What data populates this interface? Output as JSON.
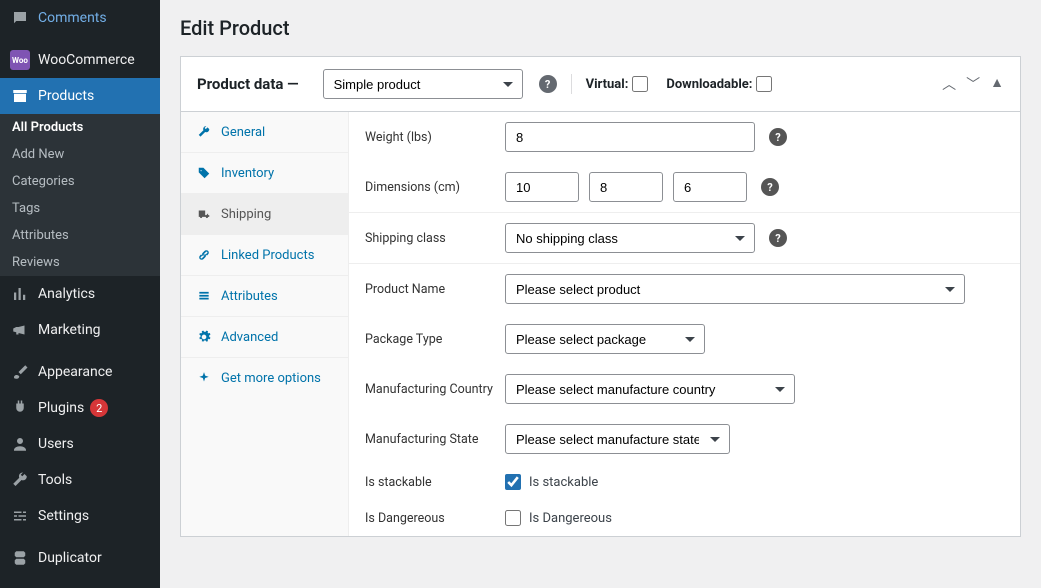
{
  "sidebar": {
    "comments": "Comments",
    "woocommerce": "WooCommerce",
    "products": "Products",
    "submenu": {
      "all": "All Products",
      "add": "Add New",
      "categories": "Categories",
      "tags": "Tags",
      "attributes": "Attributes",
      "reviews": "Reviews"
    },
    "analytics": "Analytics",
    "marketing": "Marketing",
    "appearance": "Appearance",
    "plugins": "Plugins",
    "plugins_badge": "2",
    "users": "Users",
    "tools": "Tools",
    "settings": "Settings",
    "duplicator": "Duplicator"
  },
  "page": {
    "title": "Edit Product"
  },
  "panel": {
    "label": "Product data —",
    "product_type": "Simple product",
    "virtual_label": "Virtual:",
    "downloadable_label": "Downloadable:"
  },
  "tabs": {
    "general": "General",
    "inventory": "Inventory",
    "shipping": "Shipping",
    "linked": "Linked Products",
    "attributes": "Attributes",
    "advanced": "Advanced",
    "more": "Get more options"
  },
  "form": {
    "weight_label": "Weight (lbs)",
    "weight_value": "8",
    "dimensions_label": "Dimensions (cm)",
    "dim_l": "10",
    "dim_w": "8",
    "dim_h": "6",
    "shipping_class_label": "Shipping class",
    "shipping_class_value": "No shipping class",
    "product_name_label": "Product Name",
    "product_name_value": "Please select product",
    "package_type_label": "Package Type",
    "package_type_value": "Please select package",
    "mfg_country_label": "Manufacturing Country",
    "mfg_country_value": "Please select manufacture country",
    "mfg_state_label": "Manufacturing State",
    "mfg_state_value": "Please select manufacture state",
    "stackable_label": "Is stackable",
    "stackable_cb": "Is stackable",
    "dangerous_label": "Is Dangereous",
    "dangerous_cb": "Is Dangereous"
  }
}
